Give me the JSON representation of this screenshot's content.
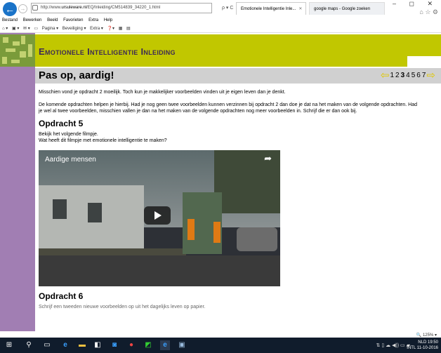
{
  "browser": {
    "url_prefix": "http://www.",
    "url_domain": "ursuleware.nl",
    "url_rest": "/EQ/Inleiding/CM514839_34220_1.html",
    "addr_controls": "ρ ▾ C",
    "tabs": [
      {
        "label": "Emotionele Intelligentie Inle..."
      },
      {
        "label": "google maps - Google zoeken"
      }
    ],
    "window_controls": "– ◻ ✕",
    "right_icons": "⌂ ☆ ⚙",
    "menu": [
      "Bestand",
      "Bewerken",
      "Beeld",
      "Favorieten",
      "Extra",
      "Help"
    ],
    "command_bar": [
      "⌂ ▾",
      "▣ ▾",
      "✉ ▾",
      "▭",
      "Pagina ▾",
      "Beveiliging ▾",
      "Extra ▾",
      "❓▾",
      "▦",
      "▤"
    ]
  },
  "site": {
    "banner_title": "Emotionele Intelligentie Inleiding",
    "page_title": "Pas op, aardig!",
    "pager": {
      "prev": "⇦",
      "next": "⇨",
      "pages": [
        "1",
        "2",
        "3",
        "4",
        "5",
        "6",
        "7"
      ],
      "current": "3"
    }
  },
  "content": {
    "p1": "Misschien vond je opdracht 2 moeilijk. Toch kun je makkelijker voorbeelden vinden uit je eigen leven dan je denkt.",
    "p2": "De komende opdrachten helpen je hierbij. Had je nog geen twee voorbeelden kunnen verzinnen bij opdracht 2 dan doe je dat na het maken van de volgende opdrachten. Had je wel al twee voorbeelden, misschien vallen je dan na het maken van de volgende opdrachten nog meer voorbeelden in. Schrijf die er dan ook bij.",
    "h_opdracht5": "Opdracht 5",
    "p3_line1": "Bekijk het volgende filmpje.",
    "p3_line2": "Wat heeft dit filmpje met emotionele intelligentie te maken?",
    "video_title": "Aardige mensen",
    "video_share": "➦",
    "h_opdracht6": "Opdracht 6",
    "cutoff_text": "Schrijf een tweeden nieuwe voorbeelden op uit het dagelijks leven op papier."
  },
  "status": {
    "zoom": "🔍 125%  ▾"
  },
  "taskbar": {
    "tray_icons": "⇅ ▯ ☁ ◀)) ▭ ▰",
    "lang_top": "NLD",
    "lang_bottom": "INTL",
    "time": "19:50",
    "date": "11-10-2016"
  },
  "colors": {
    "banner": "#c1c700",
    "sidebar": "#a17eb3",
    "arrow": "#e0c800"
  }
}
